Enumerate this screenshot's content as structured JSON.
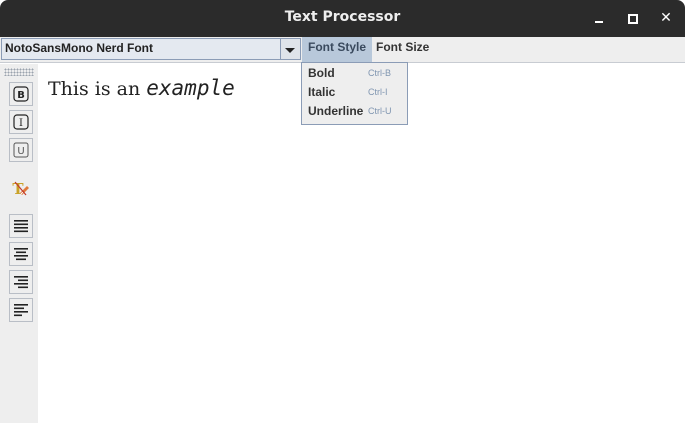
{
  "window": {
    "title": "Text Processor",
    "controls": {
      "minimize": "minimize-icon",
      "maximize": "maximize-icon",
      "close": "close-icon"
    }
  },
  "menubar": {
    "font_combo_value": "NotoSansMono Nerd Font",
    "menus": [
      {
        "label": "Font Style",
        "open": true
      },
      {
        "label": "Font Size",
        "open": false
      }
    ]
  },
  "dropdown": {
    "items": [
      {
        "label": "Bold",
        "accel": "Ctrl-B"
      },
      {
        "label": "Italic",
        "accel": "Ctrl-I"
      },
      {
        "label": "Underline",
        "accel": "Ctrl-U"
      }
    ]
  },
  "toolbar": {
    "buttons": [
      {
        "name": "bold-button",
        "icon": "bold-icon"
      },
      {
        "name": "italic-button",
        "icon": "italic-icon"
      },
      {
        "name": "underline-button",
        "icon": "underline-icon"
      },
      {
        "name": "clear-format-button",
        "icon": "clear-format-icon"
      },
      {
        "name": "align-justify-button",
        "icon": "align-justify-icon"
      },
      {
        "name": "align-center-button",
        "icon": "align-center-icon"
      },
      {
        "name": "align-right-button",
        "icon": "align-right-icon"
      },
      {
        "name": "align-left-button",
        "icon": "align-left-icon"
      }
    ]
  },
  "editor": {
    "segments": [
      {
        "text": "This is an ",
        "style": "normal"
      },
      {
        "text": "example",
        "style": "mono-italic"
      }
    ]
  },
  "colors": {
    "titlebar": "#2b2b2b",
    "menu_highlight": "#b8c8da",
    "combo_bg": "#e4e9f0",
    "accel_text": "#7f95b0"
  }
}
